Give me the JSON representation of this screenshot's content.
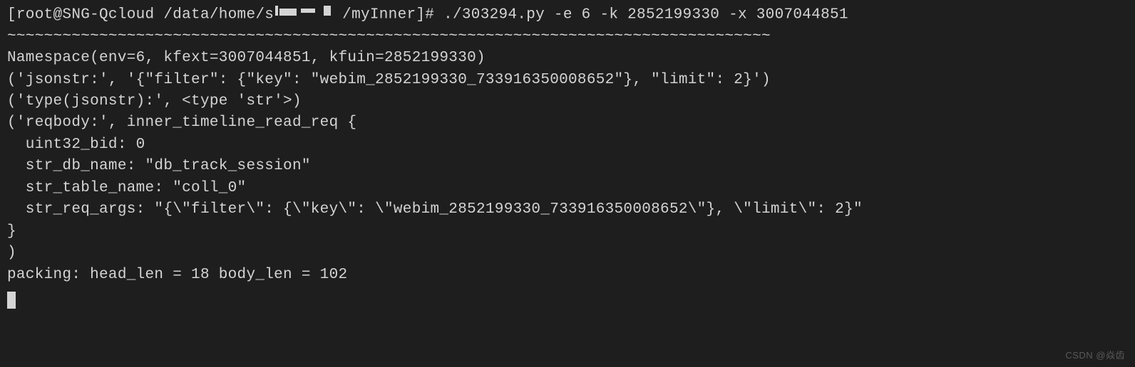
{
  "prompt": {
    "prefix": "[root@SNG-Qcloud /data/home/s",
    "suffix": "/myInner]#",
    "command": " ./303294.py -e 6 -k 2852199330 -x 3007044851"
  },
  "output": {
    "separator": "~~~~~~~~~~~~~~~~~~~~~~~~~~~~~~~~~~~~~~~~~~~~~~~~~~~~~~~~~~~~~~~~~~~~~~~~~~~~~~~~~~~",
    "namespace": "Namespace(env=6, kfext=3007044851, kfuin=2852199330)",
    "jsonstr": "('jsonstr:', '{\"filter\": {\"key\": \"webim_2852199330_733916350008652\"}, \"limit\": 2}')",
    "typejsonstr": "('type(jsonstr):', <type 'str'>)",
    "reqbody_open": "('reqbody:', inner_timeline_read_req {",
    "uint32_bid": "  uint32_bid: 0",
    "str_db_name": "  str_db_name: \"db_track_session\"",
    "str_table_name": "  str_table_name: \"coll_0\"",
    "str_req_args": "  str_req_args: \"{\\\"filter\\\": {\\\"key\\\": \\\"webim_2852199330_733916350008652\\\"}, \\\"limit\\\": 2}\"",
    "close_brace": "}",
    "close_paren": ")",
    "packing": "packing: head_len = 18 body_len = 102"
  },
  "watermark": "CSDN @焱齿"
}
